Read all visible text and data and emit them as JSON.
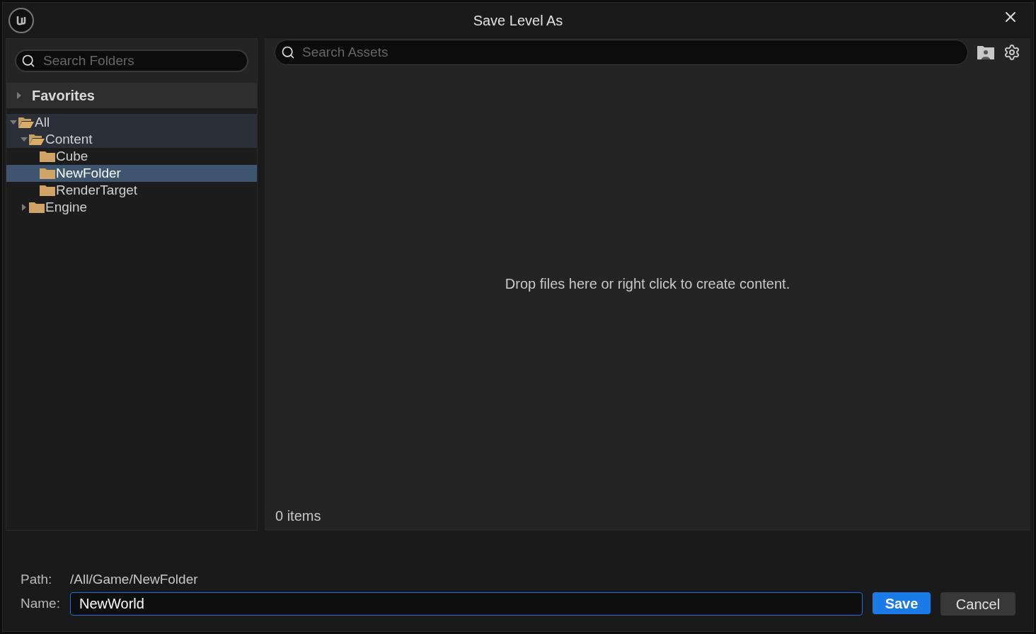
{
  "window": {
    "title": "Save Level As"
  },
  "folder_search": {
    "placeholder": "Search Folders"
  },
  "favorites": {
    "label": "Favorites",
    "expanded": false
  },
  "tree": [
    {
      "label": "All",
      "expanded": true,
      "selected": false,
      "highlighted": true,
      "children": [
        {
          "label": "Content",
          "expanded": true,
          "selected": false,
          "highlighted": true,
          "children": [
            {
              "label": "Cube",
              "selected": false,
              "highlighted": false
            },
            {
              "label": "NewFolder",
              "selected": true,
              "highlighted": false
            },
            {
              "label": "RenderTarget",
              "selected": false,
              "highlighted": false
            }
          ]
        },
        {
          "label": "Engine",
          "expanded": false,
          "selected": false,
          "highlighted": false
        }
      ]
    }
  ],
  "asset_search": {
    "placeholder": "Search Assets"
  },
  "empty_message": "Drop files here or right click to create content.",
  "item_count": "0 items",
  "path": {
    "label": "Path:",
    "value": "/All/Game/NewFolder"
  },
  "name": {
    "label": "Name:",
    "value": "NewWorld"
  },
  "buttons": [
    {
      "label": "Save",
      "kind": "primary"
    },
    {
      "label": "Cancel",
      "kind": "secondary"
    }
  ]
}
